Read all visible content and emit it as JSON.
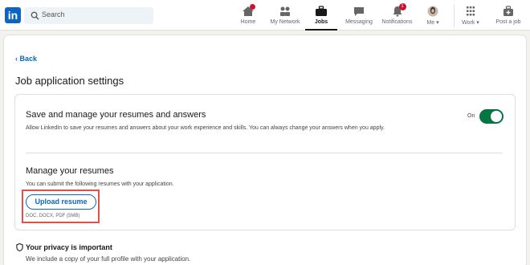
{
  "nav": {
    "logo_text": "in",
    "search_placeholder": "Search",
    "items": [
      {
        "label": "Home",
        "badge": ""
      },
      {
        "label": "My Network",
        "badge": ""
      },
      {
        "label": "Jobs",
        "badge": ""
      },
      {
        "label": "Messaging",
        "badge": ""
      },
      {
        "label": "Notifications",
        "badge": "1"
      },
      {
        "label": "Me ▾",
        "badge": ""
      },
      {
        "label": "Work ▾",
        "badge": ""
      },
      {
        "label": "Post a job",
        "badge": ""
      }
    ],
    "active": "Jobs"
  },
  "page": {
    "back_label": "Back",
    "title": "Job application settings"
  },
  "save_section": {
    "heading": "Save and manage your resumes and answers",
    "description": "Allow LinkedIn to save your resumes and answers about your work experience and skills. You can always change your answers when you apply.",
    "toggle_label": "On",
    "toggle_on": true
  },
  "resume_section": {
    "heading": "Manage your resumes",
    "description": "You can submit the following resumes with your application.",
    "upload_label": "Upload resume",
    "file_types": "DOC, DOCX, PDF (5MB)"
  },
  "privacy": {
    "heading": "Your privacy is important",
    "description": "We include a copy of your full profile with your application."
  },
  "colors": {
    "brand": "#0a66c2",
    "toggle_on": "#057642",
    "highlight": "#d9534f"
  }
}
